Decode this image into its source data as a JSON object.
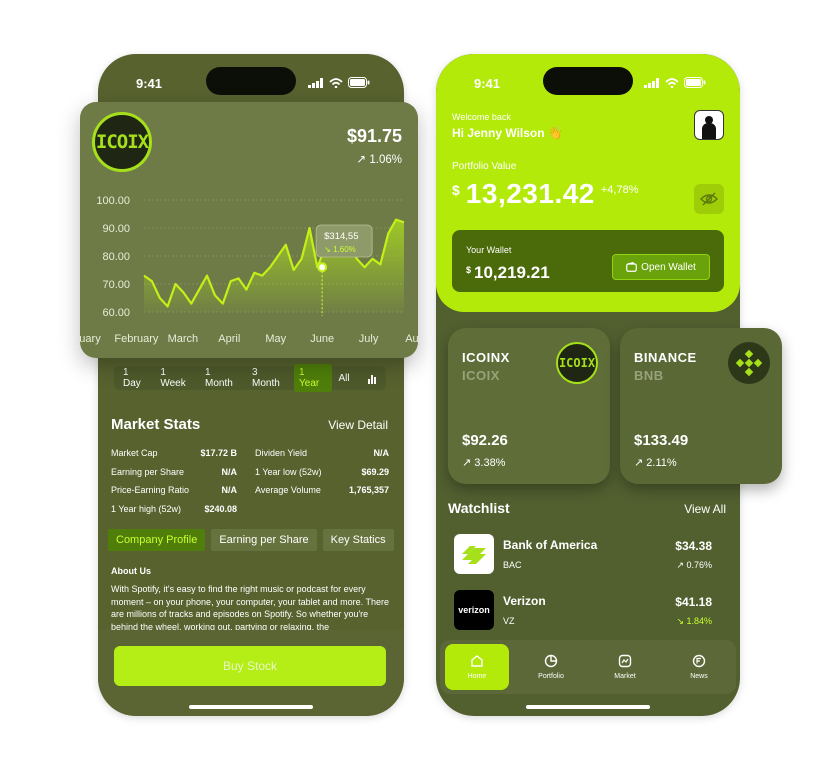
{
  "left_phone": {
    "status_time": "9:41",
    "coin_logo": "ICOIX",
    "price": "$91.75",
    "change": "↗ 1.06%",
    "tooltip_price": "$314,55",
    "tooltip_change": "↘ 1.60%",
    "ranges": [
      "1 Day",
      "1 Week",
      "1 Month",
      "3 Month",
      "1 Year",
      "All"
    ],
    "active_range": "1 Year",
    "market_stats": {
      "title": "Market Stats",
      "link": "View Detail",
      "rows": [
        {
          "l_label": "Market Cap",
          "l_val": "$17.72 B",
          "r_label": "Dividen Yield",
          "r_val": "N/A"
        },
        {
          "l_label": "Earning per Share",
          "l_val": "N/A",
          "r_label": "1 Year low (52w)",
          "r_val": "$69.29"
        },
        {
          "l_label": "Price-Earning Ratio",
          "l_val": "N/A",
          "r_label": "Average Volume",
          "r_val": "1,765,357"
        },
        {
          "l_label": "1 Year high (52w)",
          "l_val": "$240.08",
          "r_label": "",
          "r_val": ""
        }
      ]
    },
    "tabs": [
      "Company Profile",
      "Earning per Share",
      "Key Statics"
    ],
    "about_title": "About Us",
    "about_text": "With Spotify, it's easy to find the right music or podcast for every moment – on your phone, your computer, your tablet and more. There are millions of tracks and episodes on Spotify. So whether you're behind the wheel, working out, partying or relaxing, the",
    "buy_label": "Buy Stock"
  },
  "chart_data": {
    "type": "area",
    "title": "",
    "xlabel": "",
    "ylabel": "",
    "x": [
      "January",
      "February",
      "March",
      "April",
      "May",
      "June",
      "July",
      "August"
    ],
    "x_tick_labels": [
      "uary",
      "February",
      "March",
      "April",
      "May",
      "June",
      "July",
      "Aug"
    ],
    "y_ticks": [
      "100.00",
      "90.00",
      "80.00",
      "70.00",
      "60.00"
    ],
    "ylim": [
      60,
      100
    ],
    "series": [
      {
        "values": [
          73,
          71,
          65,
          62,
          70,
          67,
          63,
          68,
          73,
          66,
          63,
          71,
          72,
          68,
          74,
          73,
          76,
          80,
          84,
          75,
          79,
          90,
          76,
          83,
          82,
          85,
          88,
          79,
          76,
          79,
          77,
          88,
          93,
          92
        ]
      }
    ],
    "highlight": {
      "month": "June",
      "value": 76
    },
    "colors": {
      "line": "#c4f018",
      "fill": "#a7d620",
      "card": "#6e7b47"
    }
  },
  "right_phone": {
    "status_time": "9:41",
    "welcome": "Welcome back",
    "greeting": "Hi Jenny Wilson 👋",
    "portfolio_label": "Portfolio Value",
    "portfolio_currency": "$",
    "portfolio_value": "13,231.42",
    "portfolio_change": "+4,78%",
    "wallet_label": "Your Wallet",
    "wallet_currency": "$",
    "wallet_value": "10,219.21",
    "open_wallet": "Open Wallet",
    "coins": [
      {
        "name": "ICOINX",
        "symbol": "ICOIX",
        "price": "$92.26",
        "change": "↗ 3.38%",
        "logo": "ICOIX"
      },
      {
        "name": "BINANCE",
        "symbol": "BNB",
        "price": "$133.49",
        "change": "↗ 2.11%",
        "logo": ""
      }
    ],
    "watchlist_title": "Watchlist",
    "watchlist_link": "View All",
    "watchlist": [
      {
        "name": "Bank of America",
        "symbol": "BAC",
        "price": "$34.38",
        "change": "↗ 0.76%",
        "logo": "bank-of-america-logo"
      },
      {
        "name": "Verizon",
        "symbol": "VZ",
        "price": "$41.18",
        "change": "↘ 1.84%",
        "logo": "verizon"
      }
    ],
    "nav": [
      {
        "label": "Home",
        "icon": "home-icon"
      },
      {
        "label": "Portfolio",
        "icon": "pie-chart-icon"
      },
      {
        "label": "Market",
        "icon": "market-chart-icon"
      },
      {
        "label": "News",
        "icon": "news-icon"
      }
    ]
  }
}
